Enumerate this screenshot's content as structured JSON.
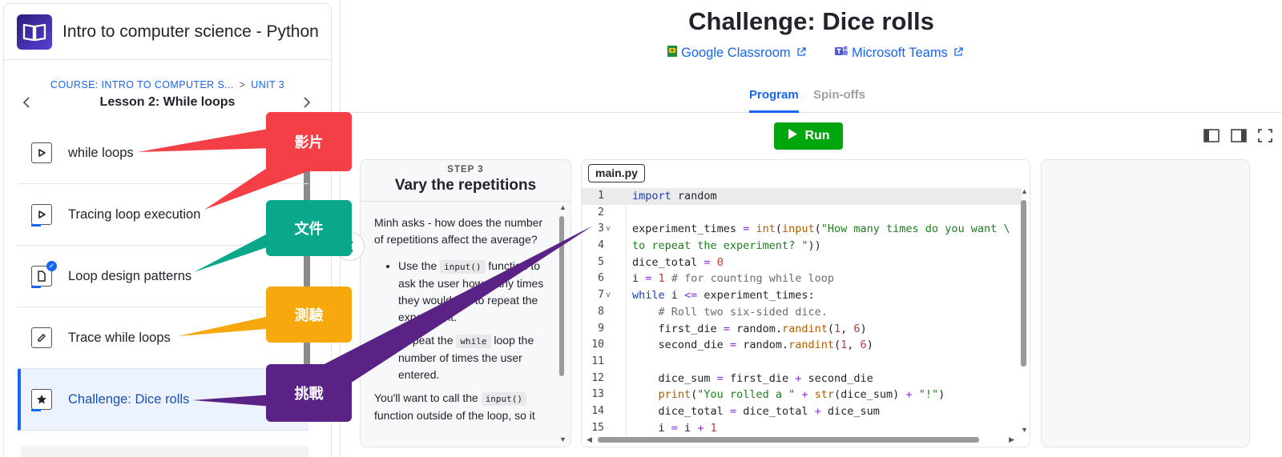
{
  "course": {
    "title": "Intro to computer science - Python",
    "breadcrumb_course": "COURSE: INTRO TO COMPUTER S...",
    "breadcrumb_sep": ">",
    "breadcrumb_unit": "UNIT 3",
    "lesson_title": "Lesson 2: While loops",
    "prev_icon": "chevron-left-icon",
    "next_icon": "chevron-right-icon"
  },
  "lesson_items": [
    {
      "label": "while loops",
      "icon": "video-play-icon"
    },
    {
      "label": "Tracing loop execution",
      "icon": "video-play-icon"
    },
    {
      "label": "Loop design patterns",
      "icon": "article-icon"
    },
    {
      "label": "Trace while loops",
      "icon": "pencil-quiz-icon"
    },
    {
      "label": "Challenge: Dice rolls",
      "icon": "star-challenge-icon"
    }
  ],
  "challenge": {
    "title": "Challenge: Dice rolls",
    "share_google": "Google Classroom",
    "share_teams": "Microsoft Teams",
    "tab_program": "Program",
    "tab_spinoffs": "Spin-offs",
    "run_label": "Run"
  },
  "step": {
    "number": "STEP 3",
    "title": "Vary the repetitions",
    "intro": "Minh asks - how does the number of repetitions affect the average?",
    "b1_pre": "Use the ",
    "b1_code": "input()",
    "b1_post": " function to ask the user how many times they would like to repeat the experiment.",
    "b2_pre": "Repeat the ",
    "b2_code": "while",
    "b2_post": " loop the number of times the user entered.",
    "p2_pre": "You'll want to call the ",
    "p2_code": "input()",
    "p2_post": " function outside of the loop, so it"
  },
  "editor": {
    "file_name": "main.py",
    "line_numbers": [
      "1",
      "2",
      "3",
      "4",
      "5",
      "6",
      "7",
      "8",
      "9",
      "10",
      "11",
      "12",
      "13",
      "14",
      "15"
    ]
  },
  "annotations": [
    {
      "label": "影片",
      "color": "#f43f46"
    },
    {
      "label": "文件",
      "color": "#0aa88b"
    },
    {
      "label": "測驗",
      "color": "#f6a80c"
    },
    {
      "label": "挑戰",
      "color": "#5b2286"
    }
  ],
  "colors": {
    "brand_blue": "#1865f2",
    "run_green": "#00a60e"
  }
}
